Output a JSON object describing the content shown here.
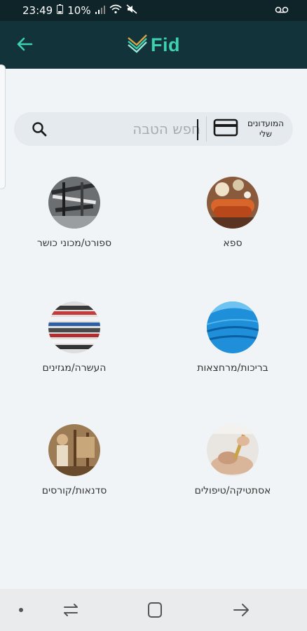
{
  "status_bar": {
    "time": "23:49",
    "battery": "10%"
  },
  "app_bar": {
    "logo_text": "Fid"
  },
  "search": {
    "placeholder": "חפש הטבה",
    "my_clubs_label": "המועדונים שלי"
  },
  "categories": [
    {
      "label": "ספא",
      "icon": "spa-image"
    },
    {
      "label": "ספורט/מכוני כושר",
      "icon": "gym-image"
    },
    {
      "label": "בריכות/מרחצאות",
      "icon": "pool-image"
    },
    {
      "label": "העשרה/מגזינים",
      "icon": "magazines-image"
    },
    {
      "label": "אסתטיקה/טיפולים",
      "icon": "aesthetics-image"
    },
    {
      "label": "סדנאות/קורסים",
      "icon": "workshops-image"
    }
  ],
  "colors": {
    "app_bar": "#12333a",
    "status_bar": "#0f2429",
    "accent": "#3ed1b0",
    "background": "#f1f4f6"
  }
}
